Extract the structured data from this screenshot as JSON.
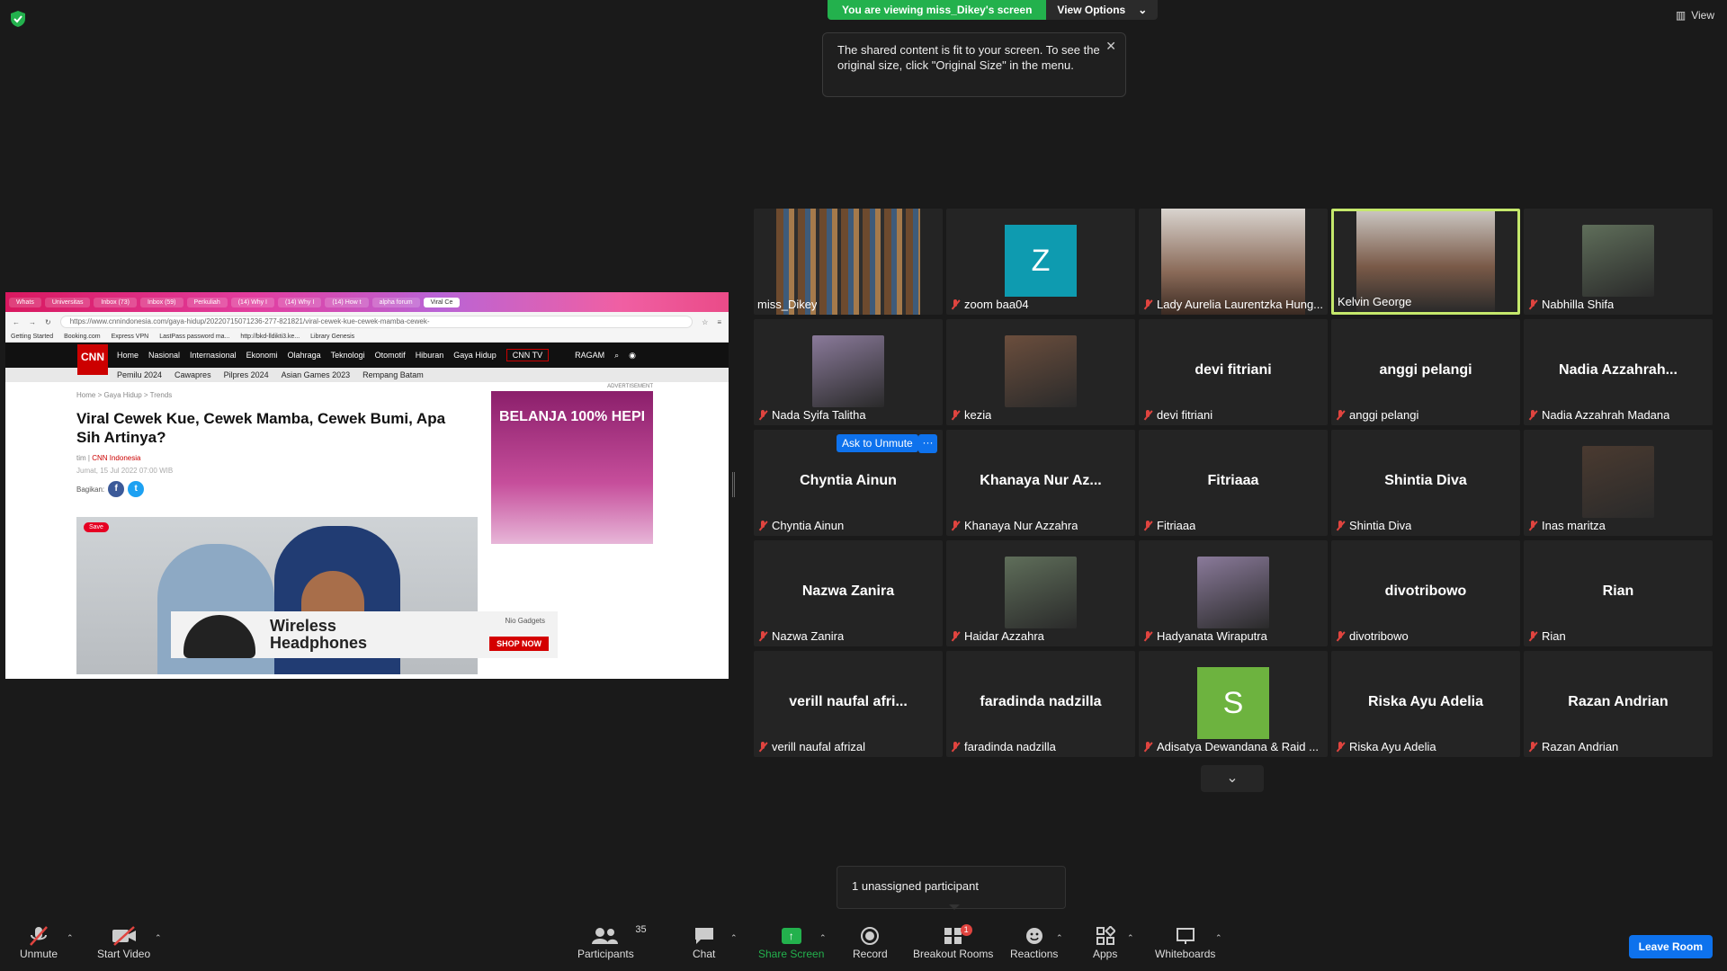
{
  "banner": {
    "viewing": "You are viewing miss_Dikey's screen",
    "view_options": "View Options"
  },
  "top_right": {
    "view": "View"
  },
  "tooltip": {
    "text": "The shared content is fit to your screen. To see the original size, click \"Original Size\" in the menu."
  },
  "shared_screen": {
    "browser": {
      "tabs": [
        "Whats",
        "Universitas",
        "Inbox (73)",
        "Inbox (59)",
        "Perkuliah",
        "(14) Why I",
        "(14) Why I",
        "(14) How t",
        "alpha forum",
        "Viral Ce"
      ],
      "url": "https://www.cnnindonesia.com/gaya-hidup/20220715071236-277-821821/viral-cewek-kue-cewek-mamba-cewek-",
      "bookmarks": [
        "Getting Started",
        "Booking.com",
        "Express VPN",
        "LastPass password ma...",
        "http://bkd-lldikti3.ke...",
        "Library Genesis"
      ]
    },
    "cnn": {
      "logo": "CNN",
      "nav": [
        "Home",
        "Nasional",
        "Internasional",
        "Ekonomi",
        "Olahraga",
        "Teknologi",
        "Otomotif",
        "Hiburan",
        "Gaya Hidup"
      ],
      "tv": "CNN TV",
      "ragam": "RAGAM",
      "subnav": [
        "Pemilu 2024",
        "Cawapres",
        "Pilpres 2024",
        "Asian Games 2023",
        "Rempang Batam"
      ],
      "breadcrumb": "Home  >  Gaya Hidup  >  Trends",
      "title": "Viral Cewek Kue, Cewek Mamba, Cewek Bumi, Apa Sih Artinya?",
      "author_prefix": "tim |",
      "author": "CNN Indonesia",
      "date": "Jumat, 15 Jul 2022 07:00 WIB",
      "share_label": "Bagikan:",
      "save": "Save",
      "ad_label": "ADVERTISEMENT",
      "ad_side": "BELANJA 100% HEPI",
      "ad_bottom_line1": "Wireless",
      "ad_bottom_line2": "Headphones",
      "ad_shop": "SHOP NOW",
      "ad_brand": "Nio Gadgets"
    }
  },
  "participants": [
    {
      "name": "miss_Dikey",
      "center": "",
      "muted": false,
      "kind": "video"
    },
    {
      "name": "zoom baa04",
      "center": "",
      "muted": true,
      "kind": "letter",
      "letter": "Z",
      "color": "#0e9bb0"
    },
    {
      "name": "Lady Aurelia Laurentzka Hung...",
      "center": "",
      "muted": true,
      "kind": "video"
    },
    {
      "name": "Kelvin George",
      "center": "",
      "muted": false,
      "kind": "video",
      "active": true
    },
    {
      "name": "Nabhilla Shifa",
      "center": "",
      "muted": true,
      "kind": "photo"
    },
    {
      "name": "Nada Syifa Talitha",
      "center": "",
      "muted": true,
      "kind": "photo"
    },
    {
      "name": "kezia",
      "center": "",
      "muted": true,
      "kind": "photo"
    },
    {
      "name": "devi fitriani",
      "center": "devi fitriani",
      "muted": true,
      "kind": "name"
    },
    {
      "name": "anggi pelangi",
      "center": "anggi pelangi",
      "muted": true,
      "kind": "name"
    },
    {
      "name": "Nadia Azzahrah Madana",
      "center": "Nadia  Azzahrah...",
      "muted": true,
      "kind": "name"
    },
    {
      "name": "Chyntia Ainun",
      "center": "Chyntia Ainun",
      "muted": true,
      "kind": "name"
    },
    {
      "name": "Khanaya Nur Azzahra",
      "center": "Khanaya Nur Az...",
      "muted": true,
      "kind": "name"
    },
    {
      "name": "Fitriaaa",
      "center": "Fitriaaa",
      "muted": true,
      "kind": "name"
    },
    {
      "name": "Shintia Diva",
      "center": "Shintia Diva",
      "muted": true,
      "kind": "name"
    },
    {
      "name": "Inas maritza",
      "center": "",
      "muted": true,
      "kind": "photo"
    },
    {
      "name": "Nazwa Zanira",
      "center": "Nazwa Zanira",
      "muted": true,
      "kind": "name"
    },
    {
      "name": "Haidar Azzahra",
      "center": "",
      "muted": true,
      "kind": "photo"
    },
    {
      "name": "Hadyanata Wiraputra",
      "center": "",
      "muted": true,
      "kind": "photo"
    },
    {
      "name": "divotribowo",
      "center": "divotribowo",
      "muted": true,
      "kind": "name"
    },
    {
      "name": "Rian",
      "center": "Rian",
      "muted": true,
      "kind": "name"
    },
    {
      "name": "verill naufal afrizal",
      "center": "verill  naufal  afri...",
      "muted": true,
      "kind": "name"
    },
    {
      "name": "faradinda nadzilla",
      "center": "faradinda nadzilla",
      "muted": true,
      "kind": "name"
    },
    {
      "name": "Adisatya Dewandana & Raid ...",
      "center": "",
      "muted": true,
      "kind": "letter",
      "letter": "S",
      "color": "#6db33f"
    },
    {
      "name": "Riska Ayu Adelia",
      "center": "Riska Ayu Adelia",
      "muted": true,
      "kind": "name"
    },
    {
      "name": "Razan Andrian",
      "center": "Razan Andrian",
      "muted": true,
      "kind": "name"
    }
  ],
  "ask_unmute": "Ask to Unmute",
  "more": "···",
  "unassigned": "1 unassigned participant",
  "toolbar": {
    "unmute": "Unmute",
    "start_video": "Start Video",
    "participants": "Participants",
    "participants_count": "35",
    "chat": "Chat",
    "share_screen": "Share Screen",
    "record": "Record",
    "breakout_rooms": "Breakout Rooms",
    "breakout_badge": "1",
    "reactions": "Reactions",
    "apps": "Apps",
    "whiteboards": "Whiteboards",
    "leave": "Leave Room"
  },
  "colors": {
    "accent_blue": "#0e72ed",
    "share_green": "#23b14d",
    "active_border": "#c5e86c",
    "mute_red": "#e0443f"
  }
}
